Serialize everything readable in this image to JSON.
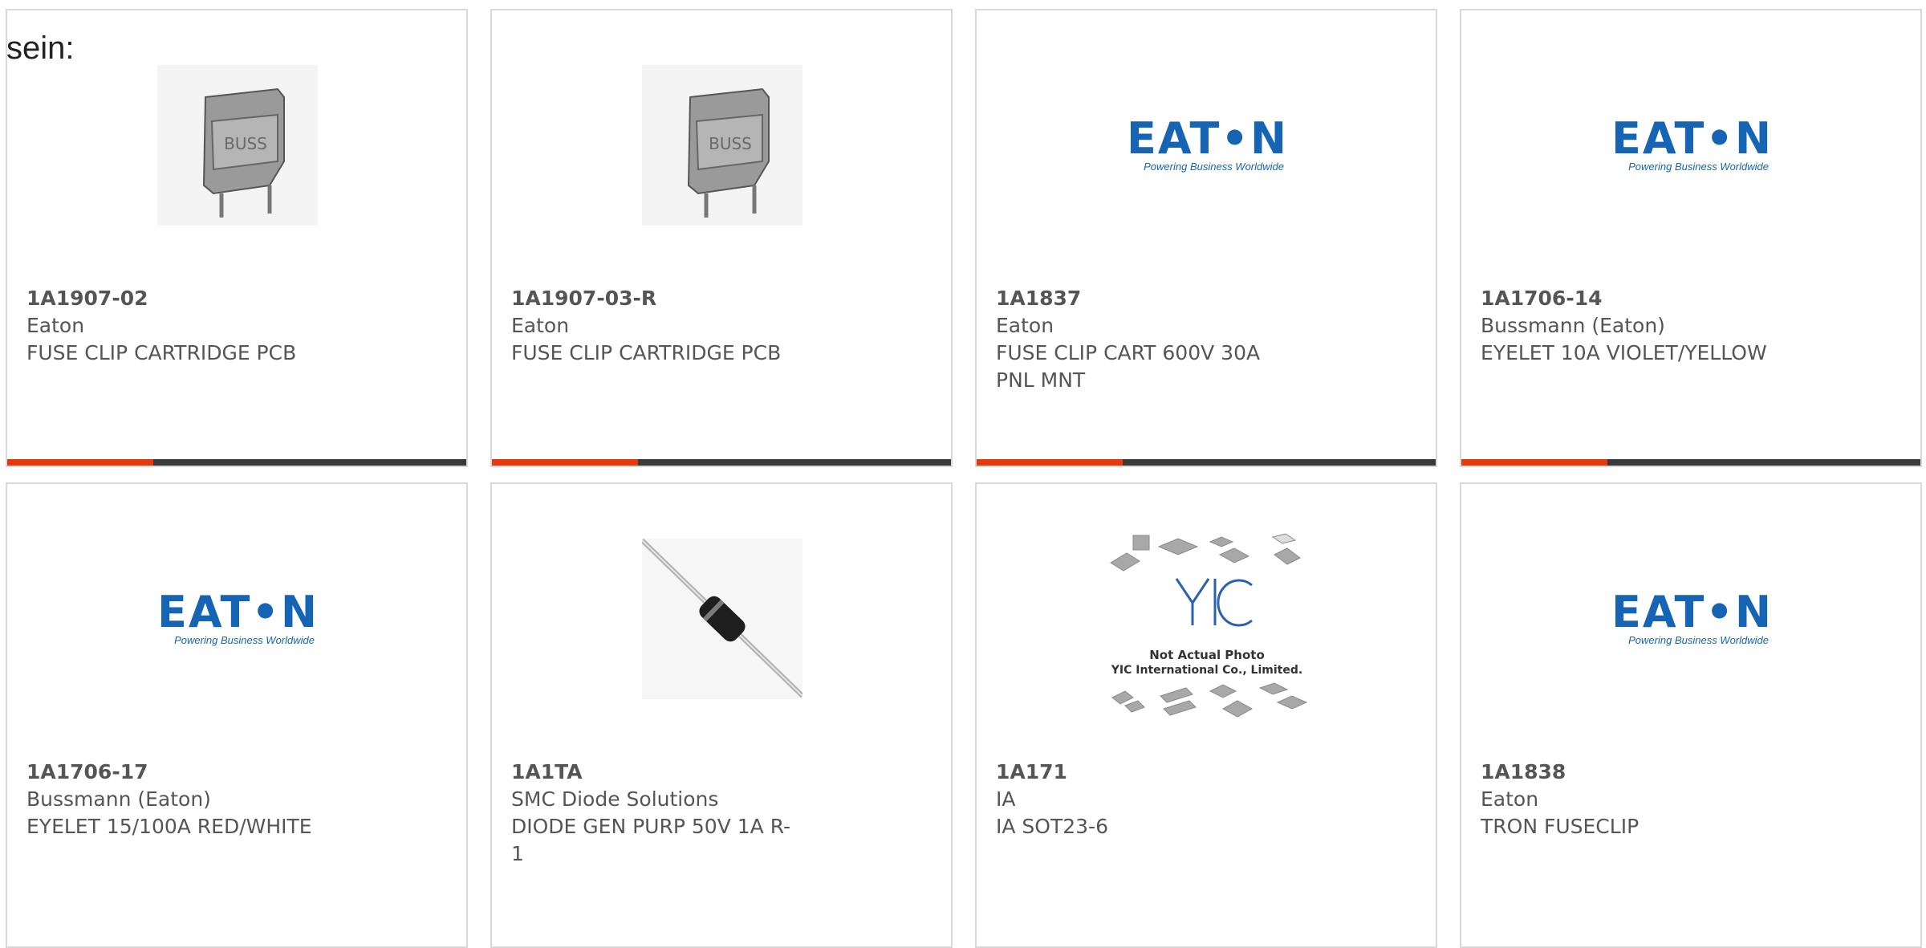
{
  "intro_text": "sein:",
  "colors": {
    "accent": "#e8380d",
    "bar": "#3a3a3a",
    "eaton_blue": "#1565b4"
  },
  "cards": [
    {
      "part": "1A1907-02",
      "mfr": "Eaton",
      "desc": "FUSE CLIP CARTRIDGE PCB",
      "image": "fuse-clip-photo",
      "image_text": "BUSS"
    },
    {
      "part": "1A1907-03-R",
      "mfr": "Eaton",
      "desc": "FUSE CLIP CARTRIDGE PCB",
      "image": "fuse-clip-photo",
      "image_text": "BUSS"
    },
    {
      "part": "1A1837",
      "mfr": "Eaton",
      "desc": "FUSE CLIP CART 600V 30A PNL MNT",
      "image": "eaton-logo",
      "image_text": "EAT•N",
      "image_tagline": "Powering Business Worldwide"
    },
    {
      "part": "1A1706-14",
      "mfr": "Bussmann (Eaton)",
      "desc": "EYELET 10A VIOLET/YELLOW",
      "image": "eaton-logo",
      "image_text": "EAT•N",
      "image_tagline": "Powering Business Worldwide"
    },
    {
      "part": "1A1706-17",
      "mfr": "Bussmann (Eaton)",
      "desc": "EYELET 15/100A RED/WHITE",
      "image": "eaton-logo",
      "image_text": "EAT•N",
      "image_tagline": "Powering Business Worldwide"
    },
    {
      "part": "1A1TA",
      "mfr": "SMC Diode Solutions",
      "desc": "DIODE GEN PURP 50V 1A R-1",
      "image": "axial-diode-photo"
    },
    {
      "part": "1A171",
      "mfr": "IA",
      "desc": "IA SOT23-6",
      "image": "yic-placeholder",
      "image_text": "Not Actual Photo",
      "image_text2": "YIC International Co., Limited."
    },
    {
      "part": "1A1838",
      "mfr": "Eaton",
      "desc": "TRON FUSECLIP",
      "image": "eaton-logo",
      "image_text": "EAT•N",
      "image_tagline": "Powering Business Worldwide"
    }
  ]
}
